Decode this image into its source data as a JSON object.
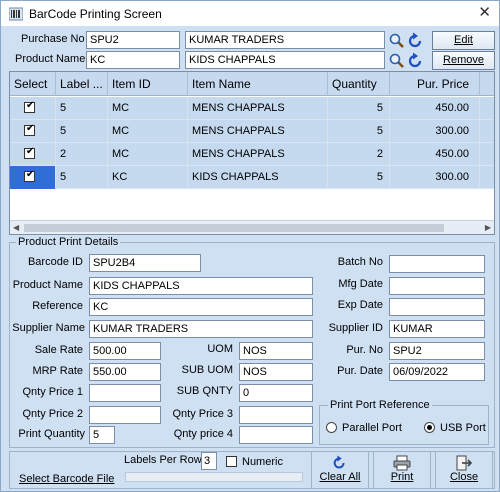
{
  "window": {
    "title": "BarCode Printing Screen"
  },
  "header": {
    "purchase_no_label": "Purchase No",
    "purchase_no_value": "SPU2",
    "supplier_name_value": "KUMAR TRADERS",
    "product_name_label": "Product Name",
    "product_code_value": "KC",
    "product_name_value": "KIDS CHAPPALS",
    "edit_label": "Edit",
    "remove_label": "Remove"
  },
  "grid": {
    "columns": [
      "Select",
      "Label ...",
      "Item ID",
      "Item Name",
      "Quantity",
      "Pur. Price"
    ],
    "rows": [
      {
        "label": "5",
        "item_id": "MC",
        "item_name": "MENS CHAPPALS",
        "quantity": "5",
        "price": "450.00"
      },
      {
        "label": "5",
        "item_id": "MC",
        "item_name": "MENS CHAPPALS",
        "quantity": "5",
        "price": "300.00"
      },
      {
        "label": "2",
        "item_id": "MC",
        "item_name": "MENS CHAPPALS",
        "quantity": "2",
        "price": "450.00"
      },
      {
        "label": "5",
        "item_id": "KC",
        "item_name": "KIDS CHAPPALS",
        "quantity": "5",
        "price": "300.00"
      }
    ]
  },
  "details": {
    "legend": "Product Print Details",
    "barcode_id_label": "Barcode ID",
    "barcode_id": "SPU2B4",
    "product_name_label": "Product Name",
    "product_name": "KIDS CHAPPALS",
    "reference_label": "Reference",
    "reference": "KC",
    "supplier_name_label": "Supplier Name",
    "supplier_name": "KUMAR TRADERS",
    "sale_rate_label": "Sale Rate",
    "sale_rate": "500.00",
    "mrp_rate_label": "MRP Rate",
    "mrp_rate": "550.00",
    "qnty_price1_label": "Qnty Price 1",
    "qnty_price1": "",
    "qnty_price2_label": "Qnty Price 2",
    "qnty_price2": "",
    "print_quantity_label": "Print Quantity",
    "print_quantity": "5",
    "uom_label": "UOM",
    "uom": "NOS",
    "sub_uom_label": "SUB UOM",
    "sub_uom": "NOS",
    "sub_qnty_label": "SUB QNTY",
    "sub_qnty": "0",
    "qnty_price3_label": "Qnty Price 3",
    "qnty_price3": "",
    "qnty_price4_label": "Qnty price 4",
    "qnty_price4": "",
    "batch_no_label": "Batch No",
    "batch_no": "",
    "mfg_date_label": "Mfg Date",
    "mfg_date": "",
    "exp_date_label": "Exp Date",
    "exp_date": "",
    "supplier_id_label": "Supplier ID",
    "supplier_id": "KUMAR",
    "pur_no_label": "Pur. No",
    "pur_no": "SPU2",
    "pur_date_label": "Pur. Date",
    "pur_date": "06/09/2022"
  },
  "print_port": {
    "legend": "Print Port Reference",
    "parallel_label": "Parallel Port",
    "usb_label": "USB Port",
    "selected": "USB Port"
  },
  "bottom": {
    "labels_per_row_label": "Labels Per Row",
    "labels_per_row": "3",
    "numeric_label": "Numeric",
    "select_file_label": "Select Barcode File",
    "clear_all_label": "Clear All",
    "print_label": "Print",
    "close_label": "Close"
  },
  "colors": {
    "window_bg": "#cfe0f3",
    "selection": "#2e6ed6",
    "refresh_icon": "#1f4fbf"
  }
}
